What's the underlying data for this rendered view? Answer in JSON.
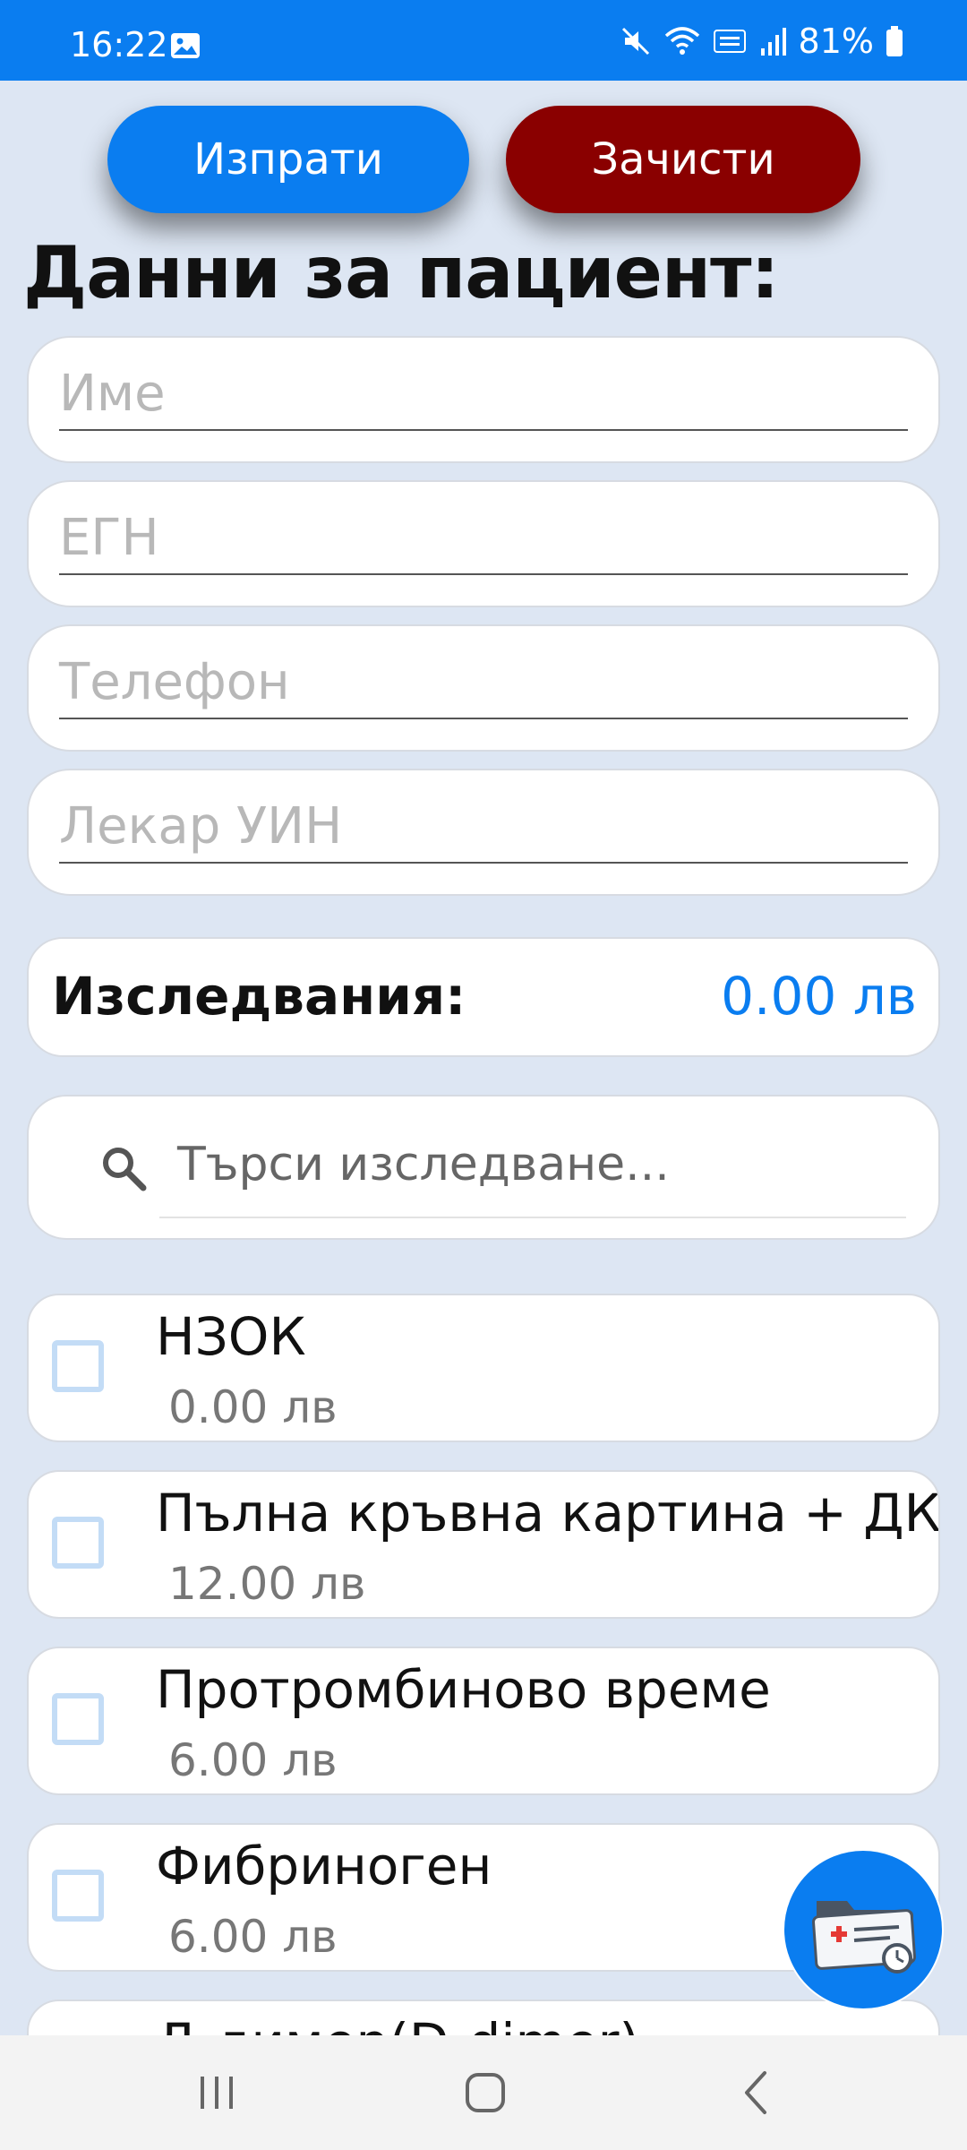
{
  "status_bar": {
    "time": "16:22",
    "battery": "81%",
    "icons": [
      "image-icon",
      "mute-icon",
      "wifi-icon",
      "volte-icon",
      "signal-icon",
      "battery-icon"
    ]
  },
  "actions": {
    "send_label": "Изпрати",
    "clear_label": "Зачисти"
  },
  "patient": {
    "title": "Данни за пациент:",
    "fields": [
      {
        "placeholder": "Име"
      },
      {
        "placeholder": "ЕГН"
      },
      {
        "placeholder": "Телефон"
      },
      {
        "placeholder": "Лекар УИН"
      }
    ]
  },
  "summary": {
    "label": "Изследвания:",
    "total": "0.00 лв"
  },
  "search": {
    "placeholder": "Търси изследване..."
  },
  "tests": [
    {
      "name": "НЗОК",
      "price": "0.00 лв",
      "checked": false
    },
    {
      "name": "Пълна кръвна картина + ДКК",
      "price": "12.00 лв",
      "checked": false
    },
    {
      "name": "Протромбиново време",
      "price": "6.00 лв",
      "checked": false
    },
    {
      "name": "Фибриноген",
      "price": "6.00 лв",
      "checked": false
    },
    {
      "name": "Д-димер(D-dimer)",
      "price": "",
      "checked": false
    }
  ],
  "colors": {
    "accent": "#0a7df0",
    "danger": "#8a0000",
    "background": "#dde6f3"
  },
  "fab": {
    "icon": "medical-record-icon"
  },
  "nav": {
    "icons": [
      "recents-icon",
      "home-icon",
      "back-icon"
    ]
  }
}
